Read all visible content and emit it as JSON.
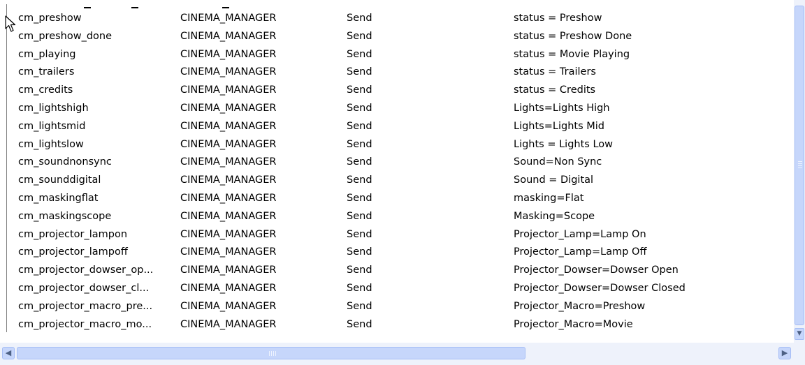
{
  "list": {
    "rows": [
      {
        "name": "cm_preshow",
        "device": "CINEMA_MANAGER",
        "action": "Send",
        "value": "status = Preshow"
      },
      {
        "name": "cm_preshow_done",
        "device": "CINEMA_MANAGER",
        "action": "Send",
        "value": "status = Preshow Done"
      },
      {
        "name": "cm_playing",
        "device": "CINEMA_MANAGER",
        "action": "Send",
        "value": "status = Movie Playing"
      },
      {
        "name": "cm_trailers",
        "device": "CINEMA_MANAGER",
        "action": "Send",
        "value": "status = Trailers"
      },
      {
        "name": "cm_credits",
        "device": "CINEMA_MANAGER",
        "action": "Send",
        "value": "status = Credits"
      },
      {
        "name": "cm_lightshigh",
        "device": "CINEMA_MANAGER",
        "action": "Send",
        "value": "Lights=Lights High"
      },
      {
        "name": "cm_lightsmid",
        "device": "CINEMA_MANAGER",
        "action": "Send",
        "value": "Lights=Lights Mid"
      },
      {
        "name": "cm_lightslow",
        "device": "CINEMA_MANAGER",
        "action": "Send",
        "value": "Lights = Lights Low"
      },
      {
        "name": "cm_soundnonsync",
        "device": "CINEMA_MANAGER",
        "action": "Send",
        "value": "Sound=Non Sync"
      },
      {
        "name": "cm_sounddigital",
        "device": "CINEMA_MANAGER",
        "action": "Send",
        "value": "Sound = Digital"
      },
      {
        "name": "cm_maskingflat",
        "device": "CINEMA_MANAGER",
        "action": "Send",
        "value": "masking=Flat"
      },
      {
        "name": "cm_maskingscope",
        "device": "CINEMA_MANAGER",
        "action": "Send",
        "value": "Masking=Scope"
      },
      {
        "name": "cm_projector_lampon",
        "device": "CINEMA_MANAGER",
        "action": "Send",
        "value": "Projector_Lamp=Lamp On"
      },
      {
        "name": "cm_projector_lampoff",
        "device": "CINEMA_MANAGER",
        "action": "Send",
        "value": "Projector_Lamp=Lamp Off"
      },
      {
        "name": "cm_projector_dowser_op...",
        "device": "CINEMA_MANAGER",
        "action": "Send",
        "value": "Projector_Dowser=Dowser Open"
      },
      {
        "name": "cm_projector_dowser_cl...",
        "device": "CINEMA_MANAGER",
        "action": "Send",
        "value": "Projector_Dowser=Dowser Closed"
      },
      {
        "name": "cm_projector_macro_pre...",
        "device": "CINEMA_MANAGER",
        "action": "Send",
        "value": "Projector_Macro=Preshow"
      },
      {
        "name": "cm_projector_macro_mo...",
        "device": "CINEMA_MANAGER",
        "action": "Send",
        "value": "Projector_Macro=Movie"
      }
    ]
  },
  "icons": {
    "cursor": "mouse-pointer-icon",
    "scroll_left": "arrow-left-icon",
    "scroll_right": "arrow-right-icon",
    "scroll_down": "arrow-down-icon",
    "scroll_grip": "grip-icon"
  },
  "colors": {
    "scrollbar_track": "#eef2fb",
    "scrollbar_thumb": "#c6d6fb",
    "scrollbar_border": "#a5bdf5",
    "row_text": "#000000"
  }
}
